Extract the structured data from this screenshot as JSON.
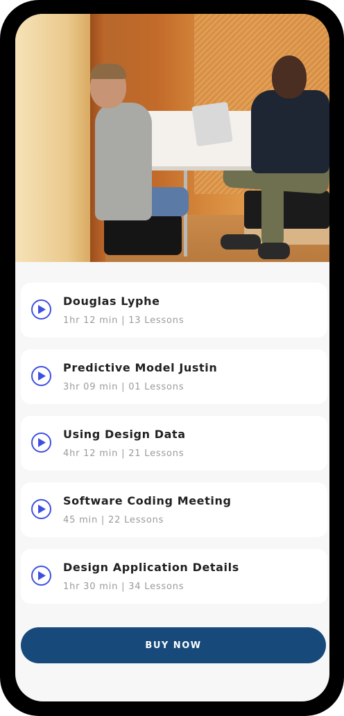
{
  "colors": {
    "accent": "#3f4fe0",
    "button_bg": "#174a7b",
    "card_bg": "#ffffff",
    "screen_bg": "#f7f7f7"
  },
  "courses": [
    {
      "title": "Douglas Lyphe",
      "meta": "1hr 12 min | 13 Lessons",
      "icon": "play-circle-icon"
    },
    {
      "title": "Predictive Model Justin",
      "meta": "3hr 09 min | 01 Lessons",
      "icon": "play-circle-icon"
    },
    {
      "title": "Using Design Data",
      "meta": "4hr 12 min | 21 Lessons",
      "icon": "play-circle-icon"
    },
    {
      "title": "Software Coding Meeting",
      "meta": "45 min | 22 Lessons",
      "icon": "play-circle-icon"
    },
    {
      "title": "Design Application Details",
      "meta": "1hr 30 min | 34 Lessons",
      "icon": "play-circle-icon"
    }
  ],
  "buy_button": {
    "label": "BUY NOW"
  }
}
